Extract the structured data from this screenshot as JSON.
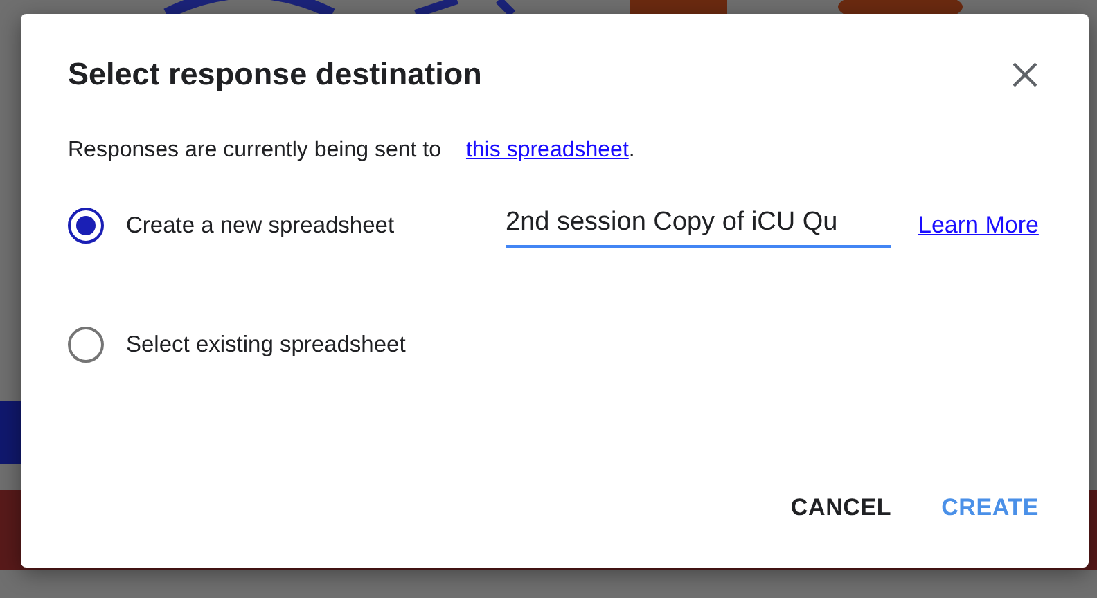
{
  "dialog": {
    "title": "Select response destination",
    "intro": {
      "text": "Responses are currently being sent to",
      "link": "this spreadsheet",
      "after": "."
    },
    "options": [
      {
        "label": "Create a new spreadsheet",
        "selected": true,
        "field": {
          "value": "2nd session Copy of iCU Qu",
          "focused": true
        },
        "link": "Learn More"
      },
      {
        "label": "Select existing spreadsheet",
        "selected": false
      }
    ],
    "buttons": [
      {
        "label": "CANCEL",
        "kind": "plain"
      },
      {
        "label": "CREATE",
        "kind": "primary"
      }
    ]
  }
}
